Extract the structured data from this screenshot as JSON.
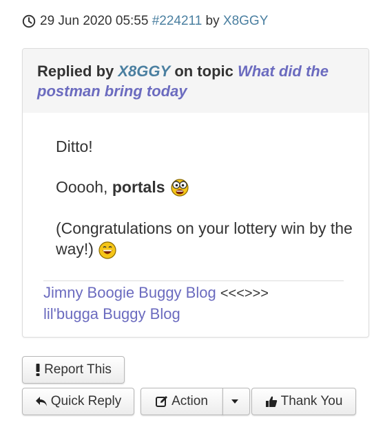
{
  "meta": {
    "date": "29 Jun 2020 05:55",
    "post_id": "#224211",
    "by": "by",
    "author": "X8GGY"
  },
  "post": {
    "header": {
      "prefix": "Replied by",
      "user": "X8GGY",
      "mid": "on topic",
      "topic": "What did the postman bring today"
    },
    "paragraphs": {
      "p1": "Ditto!",
      "p2_start": "Ooooh,",
      "p2_bold": "portals",
      "p3": "(Congratulations on your lottery win by the way!)"
    },
    "signature": {
      "link1": "Jimny Boogie Buggy Blog",
      "separator": "<<<>>>",
      "link2": "lil'bugga Buggy Blog"
    }
  },
  "actions": {
    "report": "Report This",
    "quick_reply": "Quick Reply",
    "action": "Action",
    "thank_you": "Thank You"
  },
  "icons": {
    "clock": "clock-icon",
    "exclamation": "exclamation-icon",
    "reply": "reply-arrow-icon",
    "edit": "edit-icon",
    "caret": "caret-down-icon",
    "thumbs_up": "thumbs-up-icon",
    "emoji_surprised": "surprised-emoji-icon",
    "emoji_laugh": "laughing-emoji-icon"
  },
  "colors": {
    "user_link": "#4a7fa0",
    "topic_link": "#6b6bbf",
    "header_bg": "#f5f5f5"
  }
}
